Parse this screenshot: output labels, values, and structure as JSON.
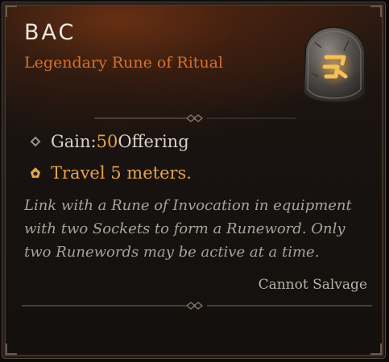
{
  "rune": {
    "name": "BAC",
    "type_line": "Legendary Rune of Ritual",
    "icon": "rune-bac-icon"
  },
  "stats": {
    "gain_prefix": "Gain: ",
    "gain_value": "50",
    "gain_suffix": " Offering",
    "travel": "Travel 5 meters."
  },
  "description": "Link with a Rune of Invocation in equipment with two Sockets to form a Runeword. Only two Runewords may be active at a time.",
  "footer": {
    "salvage": "Cannot Salvage"
  },
  "colors": {
    "legendary": "#d9702a",
    "highlight": "#e6a24a",
    "title": "#efe7df",
    "body": "#d8d2c8",
    "flavor": "#a8a29a"
  }
}
